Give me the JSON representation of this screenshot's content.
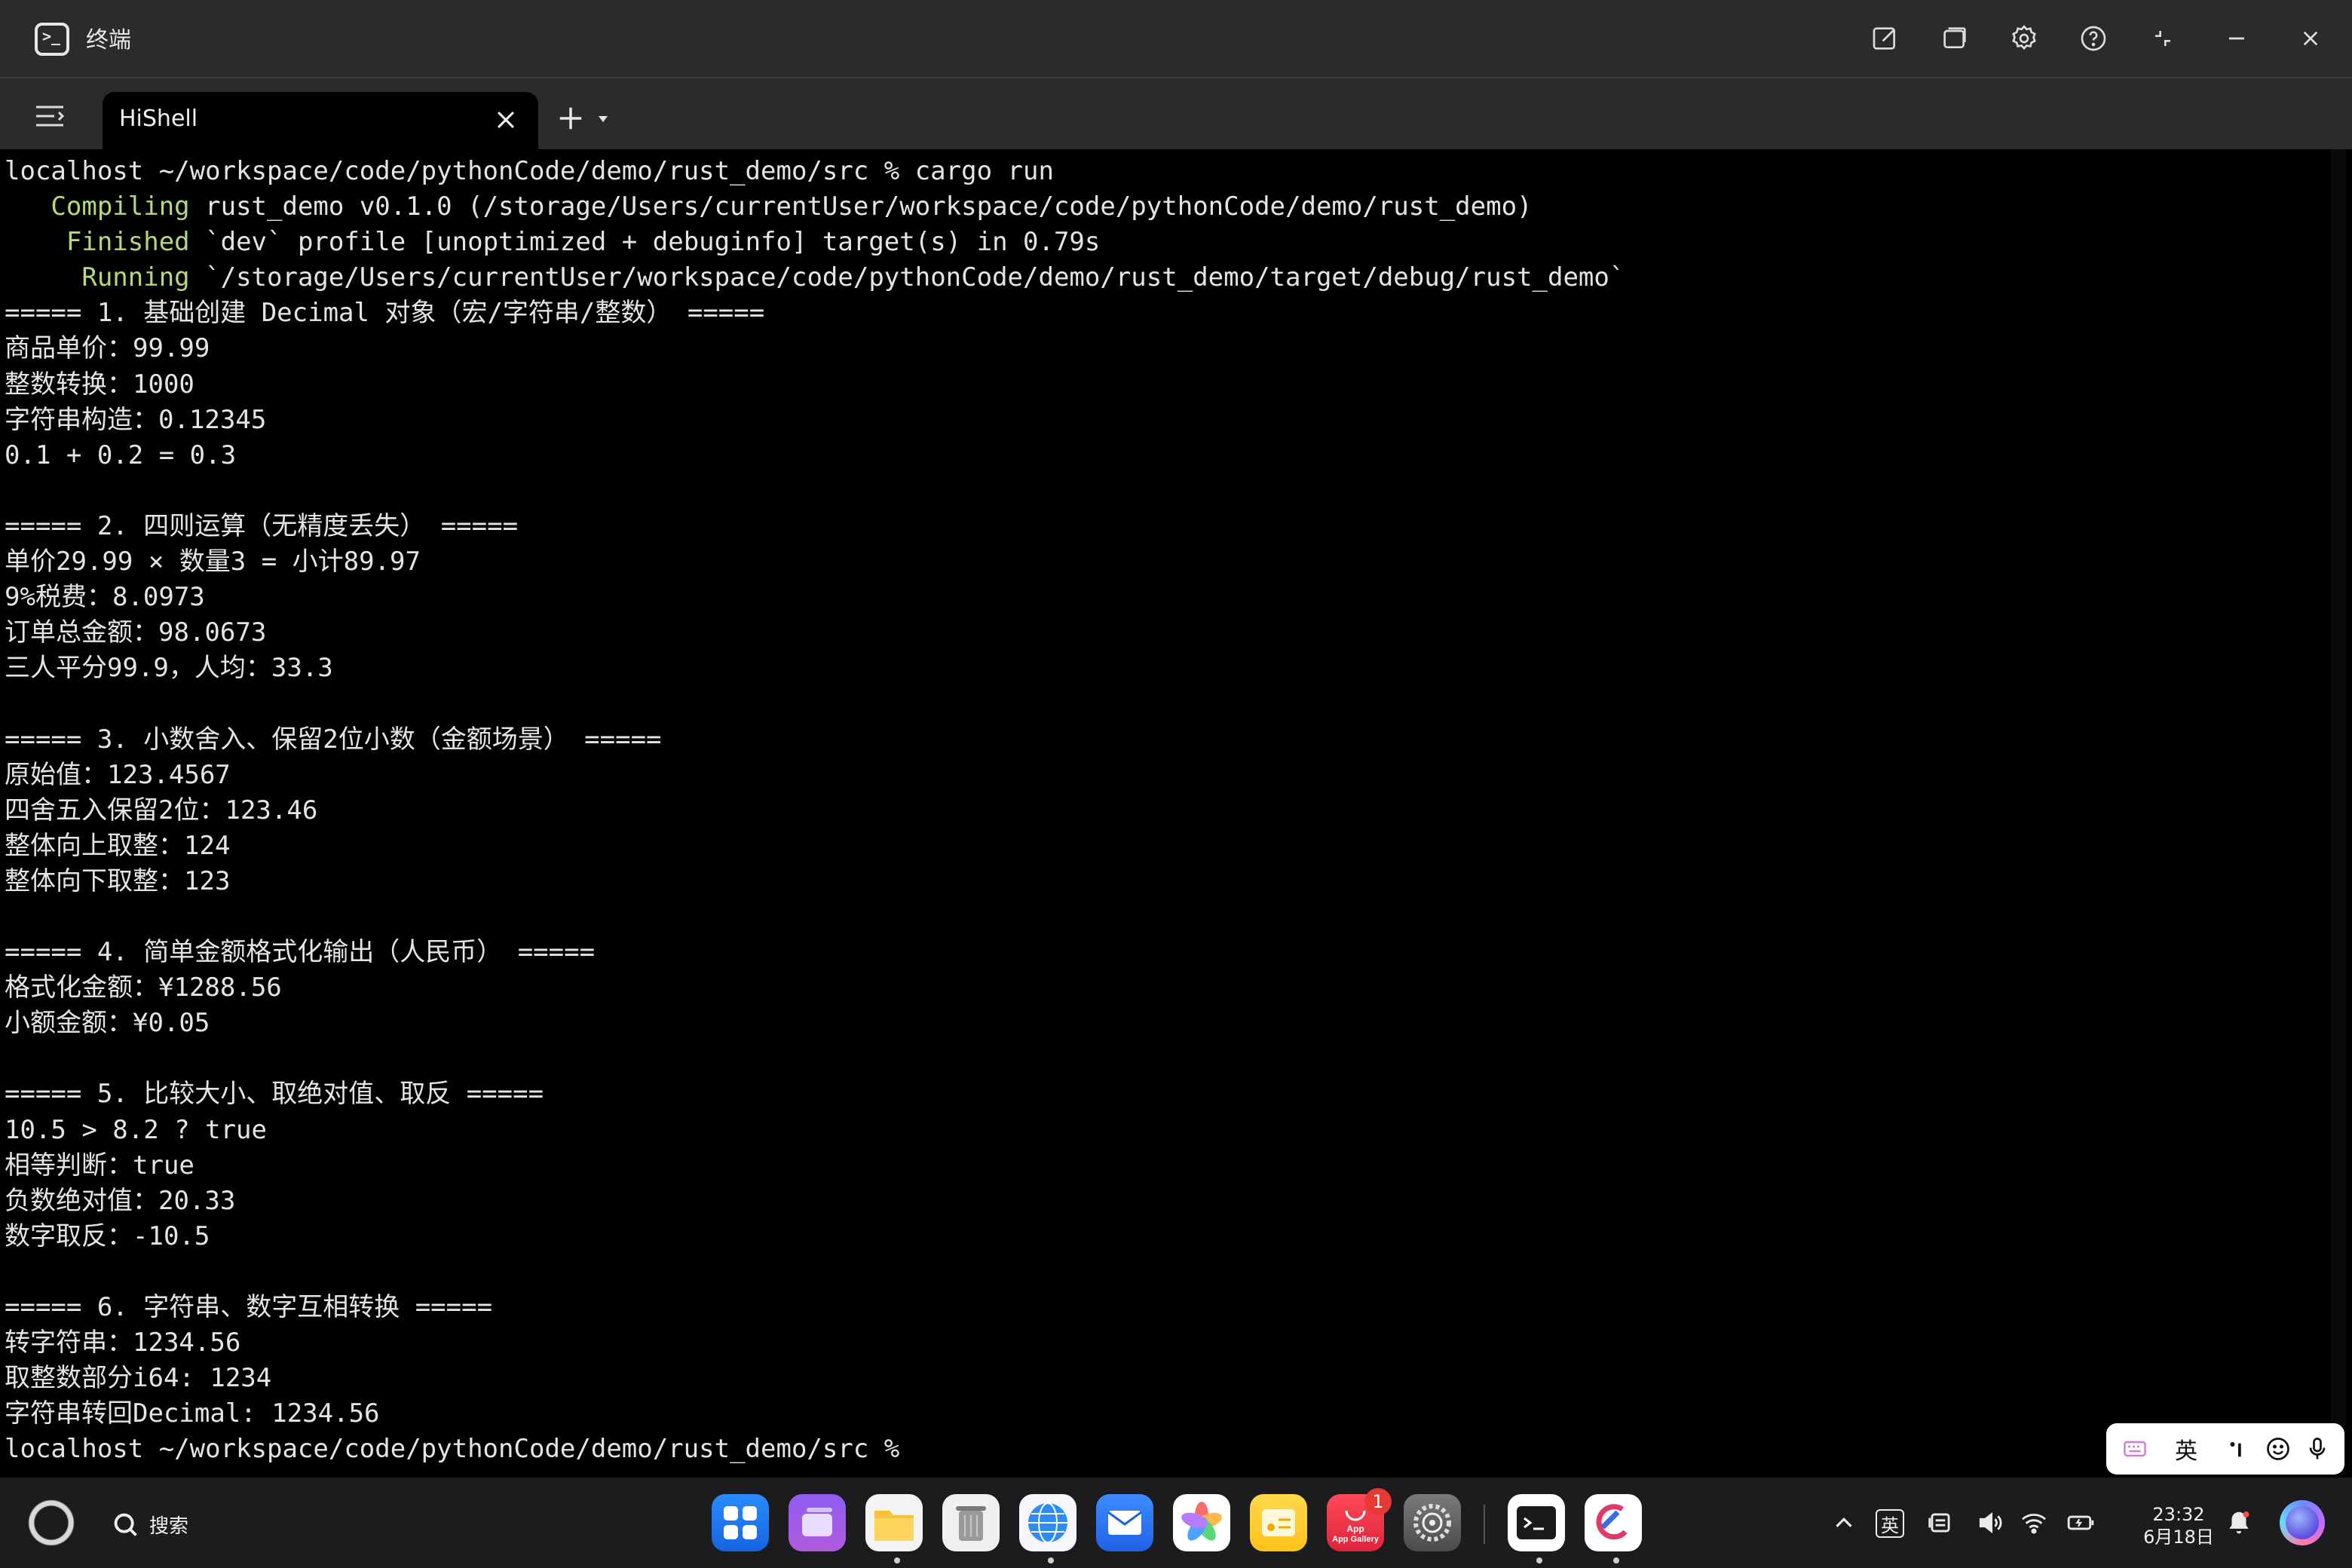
{
  "window": {
    "title": "终端"
  },
  "tabs": [
    {
      "label": "HiShell"
    }
  ],
  "terminal": {
    "lines": [
      "localhost ~/workspace/code/pythonCode/demo/rust_demo/src % cargo run",
      "   Compiling rust_demo v0.1.0 (/storage/Users/currentUser/workspace/code/pythonCode/demo/rust_demo)",
      "    Finished `dev` profile [unoptimized + debuginfo] target(s) in 0.79s",
      "     Running `/storage/Users/currentUser/workspace/code/pythonCode/demo/rust_demo/target/debug/rust_demo`",
      "===== 1. 基础创建 Decimal 对象（宏/字符串/整数） =====",
      "商品单价：99.99",
      "整数转换：1000",
      "字符串构造：0.12345",
      "0.1 + 0.2 = 0.3",
      "",
      "===== 2. 四则运算（无精度丢失） =====",
      "单价29.99 × 数量3 = 小计89.97",
      "9%税费：8.0973",
      "订单总金额：98.0673",
      "三人平分99.9，人均：33.3",
      "",
      "===== 3. 小数舍入、保留2位小数（金额场景） =====",
      "原始值：123.4567",
      "四舍五入保留2位：123.46",
      "整体向上取整：124",
      "整体向下取整：123",
      "",
      "===== 4. 简单金额格式化输出（人民币） =====",
      "格式化金额：¥1288.56",
      "小额金额：¥0.05",
      "",
      "===== 5. 比较大小、取绝对值、取反 =====",
      "10.5 > 8.2 ? true",
      "相等判断：true",
      "负数绝对值：20.33",
      "数字取反：-10.5",
      "",
      "===== 6. 字符串、数字互相转换 =====",
      "转字符串：1234.56",
      "取整数部分i64: 1234",
      "字符串转回Decimal: 1234.56",
      "localhost ~/workspace/code/pythonCode/demo/rust_demo/src % "
    ],
    "cargo_keywords": [
      "Compiling",
      "Finished",
      "Running"
    ],
    "keyword_color": "#b5d97a"
  },
  "ime": {
    "lang_label": "英"
  },
  "taskbar": {
    "search_label": "搜索",
    "badge_count": "1",
    "appgallery_label": "App Gallery",
    "tray_lang": "英",
    "clock_time": "23:32",
    "clock_date": "6月18日"
  }
}
